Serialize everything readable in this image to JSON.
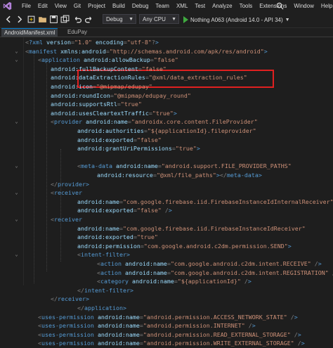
{
  "menu": {
    "items": [
      "File",
      "Edit",
      "View",
      "Git",
      "Project",
      "Build",
      "Debug",
      "Team",
      "XML",
      "Test",
      "Analyze",
      "Tools",
      "Extensions",
      "Window",
      "Help"
    ]
  },
  "toolbar": {
    "config": "Debug",
    "platform": "Any CPU",
    "run_target": "Nothing A063 (Android 14.0 - API 34)"
  },
  "tabs": [
    {
      "label": "AndroidManifest.xml",
      "active": true
    },
    {
      "label": "EduPay",
      "active": false
    }
  ],
  "code": [
    {
      "indent": 0,
      "text": "<?xml version=\"1.0\" encoding=\"utf-8\"?>"
    },
    {
      "indent": 0,
      "text": "<manifest xmlns:android=\"http://schemas.android.com/apk/res/android\">"
    },
    {
      "indent": 1,
      "text": "<application android:allowBackup=\"false\""
    },
    {
      "indent": 2,
      "text": "android:fullBackupContent=\"false\""
    },
    {
      "indent": 2,
      "text": "android:dataExtractionRules=\"@xml/data_extraction_rules\""
    },
    {
      "indent": 2,
      "text": "android:icon=\"@mipmap/edupay\""
    },
    {
      "indent": 2,
      "text": "android:roundIcon=\"@mipmap/edupay_round\""
    },
    {
      "indent": 2,
      "text": "android:supportsRtl=\"true\""
    },
    {
      "indent": 2,
      "text": "android:usesCleartextTraffic=\"true\">"
    },
    {
      "indent": 2,
      "text": "<provider android:name=\"androidx.core.content.FileProvider\""
    },
    {
      "indent": 3,
      "text": "android:authorities=\"${applicationId}.fileprovider\""
    },
    {
      "indent": 3,
      "text": "android:exported=\"false\""
    },
    {
      "indent": 3,
      "text": "android:grantUriPermissions=\"true\">"
    },
    {
      "indent": 0,
      "text": ""
    },
    {
      "indent": 3,
      "text": "<meta-data android:name=\"android.support.FILE_PROVIDER_PATHS\""
    },
    {
      "indent": 4,
      "text": "android:resource=\"@xml/file_paths\"></meta-data>"
    },
    {
      "indent": 2,
      "text": "</provider>"
    },
    {
      "indent": 2,
      "text": "<receiver"
    },
    {
      "indent": 3,
      "text": "android:name=\"com.google.firebase.iid.FirebaseInstanceIdInternalReceiver\""
    },
    {
      "indent": 3,
      "text": "android:exported=\"false\" />"
    },
    {
      "indent": 2,
      "text": "<receiver"
    },
    {
      "indent": 3,
      "text": "android:name=\"com.google.firebase.iid.FirebaseInstanceIdReceiver\""
    },
    {
      "indent": 3,
      "text": "android:exported=\"true\""
    },
    {
      "indent": 3,
      "text": "android:permission=\"com.google.android.c2dm.permission.SEND\">"
    },
    {
      "indent": 3,
      "text": "<intent-filter>"
    },
    {
      "indent": 4,
      "text": "<action android:name=\"com.google.android.c2dm.intent.RECEIVE\" />"
    },
    {
      "indent": 4,
      "text": "<action android:name=\"com.google.android.c2dm.intent.REGISTRATION\" />"
    },
    {
      "indent": 4,
      "text": "<category android:name=\"${applicationId}\" />"
    },
    {
      "indent": 3,
      "text": "</intent-filter>"
    },
    {
      "indent": 2,
      "text": "</receiver>"
    },
    {
      "indent": 3,
      "text": "</application>"
    },
    {
      "indent": 1,
      "text": "<uses-permission android:name=\"android.permission.ACCESS_NETWORK_STATE\" />"
    },
    {
      "indent": 1,
      "text": "<uses-permission android:name=\"android.permission.INTERNET\" />"
    },
    {
      "indent": 1,
      "text": "<uses-permission android:name=\"android.permission.READ_EXTERNAL_STORAGE\" />"
    },
    {
      "indent": 1,
      "text": "<uses-permission android:name=\"android.permission.WRITE_EXTERNAL_STORAGE\" />"
    }
  ],
  "colors": {
    "tag": "#569cd6",
    "attr": "#9cdcfe",
    "value": "#ce9178",
    "highlight_box": "#e02020",
    "background": "#1e1e1e"
  }
}
